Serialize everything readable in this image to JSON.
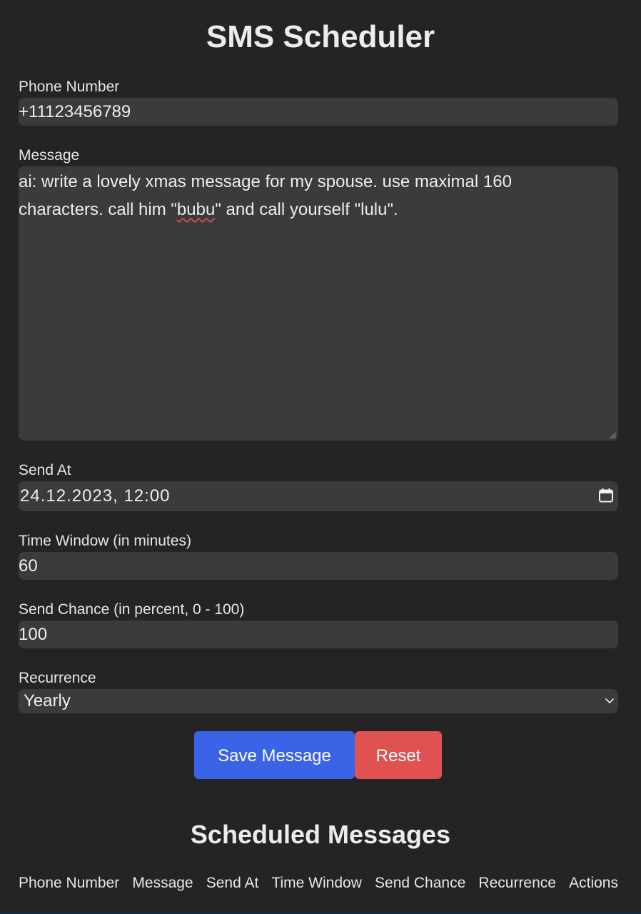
{
  "app": {
    "title": "SMS Scheduler"
  },
  "form": {
    "phone": {
      "label": "Phone Number",
      "value": "+11123456789"
    },
    "message": {
      "label": "Message",
      "value_part1": "ai: write a lovely xmas message for my spouse. use maximal 160 characters. call him \"",
      "value_misspelled": "bubu",
      "value_part2": "\" and call yourself \"lulu\"."
    },
    "send_at": {
      "label": "Send At",
      "value": "24.12.2023, 12:00",
      "icon": "calendar-icon"
    },
    "time_window": {
      "label": "Time Window (in minutes)",
      "value": "60"
    },
    "send_chance": {
      "label": "Send Chance (in percent, 0 - 100)",
      "value": "100"
    },
    "recurrence": {
      "label": "Recurrence",
      "value": "Yearly",
      "icon": "chevron-down-icon"
    }
  },
  "buttons": {
    "save_label": "Save Message",
    "reset_label": "Reset"
  },
  "scheduled": {
    "title": "Scheduled Messages",
    "columns": [
      "Phone Number",
      "Message",
      "Send At",
      "Time Window",
      "Send Chance",
      "Recurrence",
      "Actions"
    ]
  },
  "colors": {
    "background": "#242424",
    "field_bg": "#3b3b3b",
    "save_button": "#3a63e6",
    "reset_button": "#e05252",
    "text": "#e6e6e6"
  }
}
